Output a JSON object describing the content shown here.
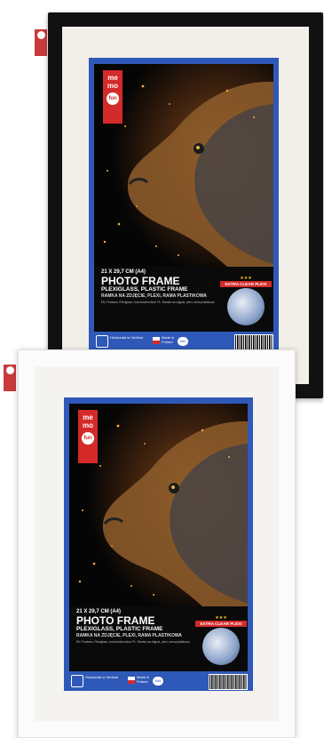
{
  "brand": {
    "logo_text": "me mo",
    "logo_dot": "fun"
  },
  "frames": [
    {
      "id": "black",
      "frame_color": "#111111",
      "insert": {
        "size": "21 X 29,7 CM (A4)",
        "title": "PHOTO FRAME",
        "subtitle_en": "PLEXIGLASS, PLASTIC FRAME",
        "subtitle_pl": "RAMKA NA ZDJĘCIE, PLEXI, RAMA PLASTIKOWA",
        "description": "EN: Features: Plexiglass, horizontal/vertical. PL: Ramka na zdjęcie, plexi, rama plastikowa.",
        "badge_stars": "★★★",
        "badge_label": "EXTRA CLEAR PLEXI",
        "footer_orientation": "Horizontal or Vertical",
        "footer_made": "Made in Poland",
        "footer_extra": "Mini"
      }
    },
    {
      "id": "white",
      "frame_color": "#fbfbfb",
      "insert": {
        "size": "21 X 29,7 CM (A4)",
        "title": "PHOTO FRAME",
        "subtitle_en": "PLEXIGLASS, PLASTIC FRAME",
        "subtitle_pl": "RAMKA NA ZDJĘCIE, PLEXI, RAMA PLASTIKOWA",
        "description": "EN: Features: Plexiglass, horizontal/vertical. PL: Ramka na zdjęcie, plexi, rama plastikowa.",
        "badge_stars": "★★★",
        "badge_label": "EXTRA CLEAR PLEXI",
        "footer_orientation": "Horizontal or Vertical",
        "footer_made": "Made in Poland",
        "footer_extra": "Mini"
      }
    }
  ],
  "colors": {
    "insert_blue": "#2f59b8",
    "brand_red": "#d42a2a",
    "spark_orange": "#f39a2b"
  },
  "icons": [
    "hanger-tag-icon",
    "orientation-icon",
    "poland-flag-icon",
    "barcode-icon"
  ]
}
